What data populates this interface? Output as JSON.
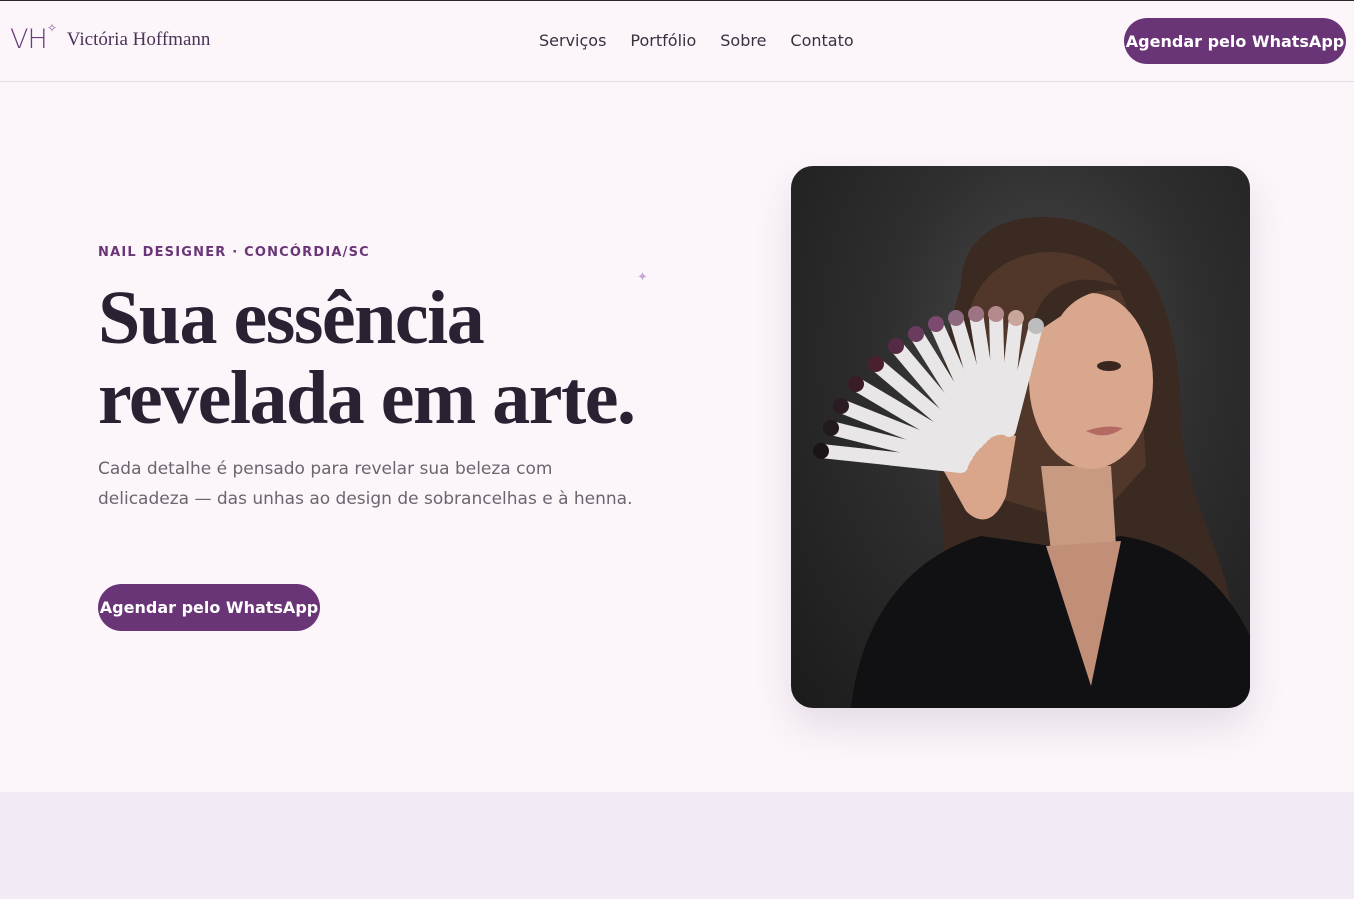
{
  "header": {
    "logo_mark": "VH",
    "logo_name": "Victória Hoffmann",
    "nav": [
      "Serviços",
      "Portfólio",
      "Sobre",
      "Contato"
    ],
    "cta_label": "Agendar pelo WhatsApp"
  },
  "hero": {
    "eyebrow": "NAIL DESIGNER · CONCÓRDIA/SC",
    "title_line1": "Sua essência",
    "title_line2": "revelada em arte.",
    "lead": "Cada detalhe é pensado para revelar sua beleza com delicadeza — das unhas ao design de sobrancelhas e à henna.",
    "cta_label": "Agendar pelo WhatsApp"
  },
  "colors": {
    "accent": "#6a3577",
    "background": "#fcf6fb",
    "lower_section": "#f2ebf5"
  }
}
